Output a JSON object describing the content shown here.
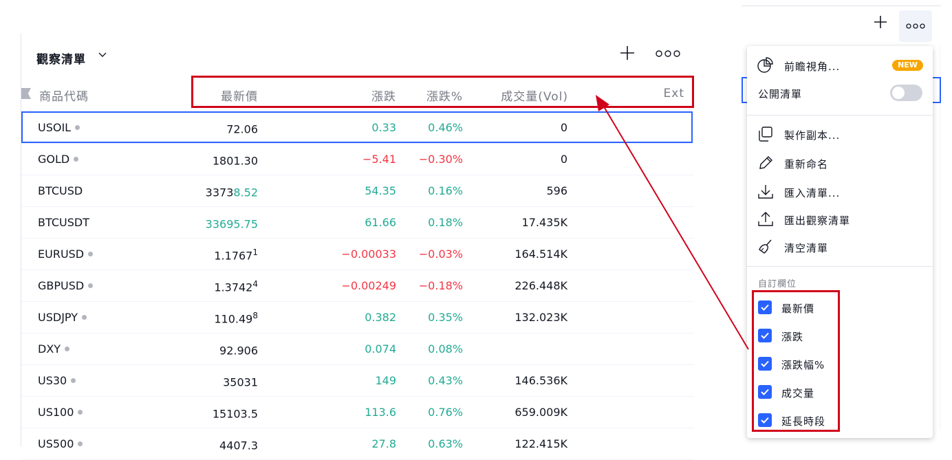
{
  "watchlist": {
    "title": "觀察清單",
    "chevron": "⌵",
    "add_icon": "+",
    "more_icon": "ooo",
    "columns": {
      "symbol": "商品代碼",
      "last": "最新價",
      "change": "漲跌",
      "change_pct": "漲跌%",
      "volume": "成交量(Vol)",
      "ext": "Ext"
    },
    "rows": [
      {
        "symbol": "USOIL",
        "dot": true,
        "last_main": "72.06",
        "last_hl": "",
        "last_sup": "",
        "change": "0.33",
        "change_pct": "0.46%",
        "volume": "0",
        "dir": "up"
      },
      {
        "symbol": "GOLD",
        "dot": true,
        "last_main": "1801.30",
        "last_hl": "",
        "last_sup": "",
        "change": "−5.41",
        "change_pct": "−0.30%",
        "volume": "0",
        "dir": "down"
      },
      {
        "symbol": "BTCUSD",
        "dot": false,
        "last_main": "3373",
        "last_hl": "8.52",
        "last_sup": "",
        "change": "54.35",
        "change_pct": "0.16%",
        "volume": "596",
        "dir": "up"
      },
      {
        "symbol": "BTCUSDT",
        "dot": false,
        "last_main": "",
        "last_hl": "33695.75",
        "last_sup": "",
        "change": "61.66",
        "change_pct": "0.18%",
        "volume": "17.435K",
        "dir": "up"
      },
      {
        "symbol": "EURUSD",
        "dot": true,
        "last_main": "1.1767",
        "last_hl": "",
        "last_sup": "1",
        "change": "−0.00033",
        "change_pct": "−0.03%",
        "volume": "164.514K",
        "dir": "down"
      },
      {
        "symbol": "GBPUSD",
        "dot": true,
        "last_main": "1.3742",
        "last_hl": "",
        "last_sup": "4",
        "change": "−0.00249",
        "change_pct": "−0.18%",
        "volume": "226.448K",
        "dir": "down"
      },
      {
        "symbol": "USDJPY",
        "dot": true,
        "last_main": "110.49",
        "last_hl": "",
        "last_sup": "8",
        "change": "0.382",
        "change_pct": "0.35%",
        "volume": "132.023K",
        "dir": "up"
      },
      {
        "symbol": "DXY",
        "dot": true,
        "last_main": "92.906",
        "last_hl": "",
        "last_sup": "",
        "change": "0.074",
        "change_pct": "0.08%",
        "volume": "",
        "dir": "up"
      },
      {
        "symbol": "US30",
        "dot": true,
        "last_main": "35031",
        "last_hl": "",
        "last_sup": "",
        "change": "149",
        "change_pct": "0.43%",
        "volume": "146.536K",
        "dir": "up"
      },
      {
        "symbol": "US100",
        "dot": true,
        "last_main": "15103.5",
        "last_hl": "",
        "last_sup": "",
        "change": "113.6",
        "change_pct": "0.76%",
        "volume": "659.009K",
        "dir": "up"
      },
      {
        "symbol": "US500",
        "dot": true,
        "last_main": "4407.3",
        "last_hl": "",
        "last_sup": "",
        "change": "27.8",
        "change_pct": "0.63%",
        "volume": "122.415K",
        "dir": "up"
      }
    ]
  },
  "toolbar": {
    "add_icon": "+",
    "more_icon": "ooo"
  },
  "menu": {
    "insights": {
      "label": "前瞻視角...",
      "badge": "NEW",
      "icon": "pie-chart-icon"
    },
    "public_list": {
      "label": "公開清單",
      "icon": "toggle-switch",
      "on": false
    },
    "copy": {
      "label": "製作副本...",
      "icon": "copy-icon"
    },
    "rename": {
      "label": "重新命名",
      "icon": "pencil-icon"
    },
    "import": {
      "label": "匯入清單...",
      "icon": "download-icon"
    },
    "export": {
      "label": "匯出觀察清單",
      "icon": "upload-icon"
    },
    "clear": {
      "label": "清空清單",
      "icon": "broom-icon"
    },
    "custom_columns_title": "自訂欄位",
    "columns": [
      {
        "label": "最新價",
        "checked": true
      },
      {
        "label": "漲跌",
        "checked": true
      },
      {
        "label": "漲跌幅%",
        "checked": true
      },
      {
        "label": "成交量",
        "checked": true
      },
      {
        "label": "延長時段",
        "checked": true
      }
    ]
  },
  "colors": {
    "up": "#22ab94",
    "down": "#f23645",
    "annotation_red": "#d0021b",
    "highlight_blue": "#2962ff",
    "badge": "#f7a600"
  }
}
